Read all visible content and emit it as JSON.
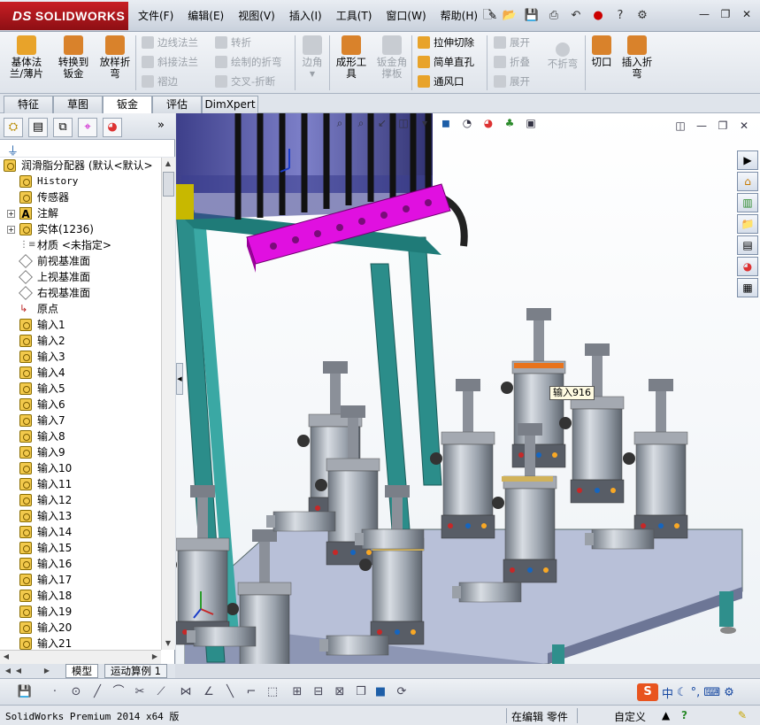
{
  "app": {
    "brand": "SOLIDWORKS",
    "brand_mark": "DS"
  },
  "menu": [
    "文件(F)",
    "编辑(E)",
    "视图(V)",
    "插入(I)",
    "工具(T)",
    "窗口(W)",
    "帮助(H)"
  ],
  "quick_icons": [
    "new-icon",
    "open-icon",
    "save-icon",
    "print-icon",
    "undo-icon",
    "traffic-light-icon",
    "help-icon",
    "options-icon"
  ],
  "window_controls": [
    "minimize-icon",
    "restore-icon",
    "close-icon"
  ],
  "command_manager": {
    "big": [
      {
        "label": "基体法\n兰/薄片",
        "color": "#e8a32a"
      },
      {
        "label": "转换到\n钣金",
        "color": "#d9822b"
      },
      {
        "label": "放样折\n弯",
        "color": "#d9822b"
      }
    ],
    "col1": [
      {
        "label": "边线法兰",
        "disabled": true
      },
      {
        "label": "斜接法兰",
        "disabled": true
      },
      {
        "label": "褶边",
        "disabled": true
      }
    ],
    "col2": [
      {
        "label": "转折",
        "disabled": true
      },
      {
        "label": "绘制的折弯",
        "disabled": true
      },
      {
        "label": "交叉-折断",
        "disabled": true
      }
    ],
    "corner": {
      "label": "边角",
      "disabled": true
    },
    "forming": {
      "label": "成形工\n具"
    },
    "gusset": {
      "label": "钣金角\n撑板",
      "disabled": true
    },
    "col3": [
      {
        "label": "拉伸切除",
        "disabled": false
      },
      {
        "label": "简单直孔",
        "disabled": false
      },
      {
        "label": "通风口",
        "disabled": false
      }
    ],
    "col4": [
      {
        "label": "展开",
        "disabled": true
      },
      {
        "label": "折叠",
        "disabled": true
      },
      {
        "label": "展开",
        "disabled": true
      }
    ],
    "nobend": {
      "label": "不折弯",
      "disabled": true
    },
    "rip": {
      "label": "切口"
    },
    "insert_bends": {
      "label": "插入折\n弯"
    }
  },
  "tabs": [
    "特征",
    "草图",
    "钣金",
    "评估",
    "DimXpert"
  ],
  "active_tab": "钣金",
  "feature_tree": {
    "root": "润滑脂分配器  (默认<默认>",
    "items": [
      {
        "label": "History",
        "icon": "history-icon",
        "expand": false
      },
      {
        "label": "传感器",
        "icon": "sensor-icon",
        "expand": false
      },
      {
        "label": "注解",
        "icon": "annotation-icon",
        "expand": true
      },
      {
        "label": "实体(1236)",
        "icon": "solid-bodies-icon",
        "expand": true
      },
      {
        "label": "材质 <未指定>",
        "icon": "material-icon",
        "expand": false
      },
      {
        "label": "前视基准面",
        "icon": "plane-icon",
        "expand": false
      },
      {
        "label": "上视基准面",
        "icon": "plane-icon",
        "expand": false
      },
      {
        "label": "右视基准面",
        "icon": "plane-icon",
        "expand": false
      },
      {
        "label": "原点",
        "icon": "origin-icon",
        "expand": false
      }
    ],
    "inputs": [
      "输入1",
      "输入2",
      "输入3",
      "输入4",
      "输入5",
      "输入6",
      "输入7",
      "输入8",
      "输入9",
      "输入10",
      "输入11",
      "输入12",
      "输入13",
      "输入14",
      "输入15",
      "输入16",
      "输入17",
      "输入18",
      "输入19",
      "输入20",
      "输入21"
    ]
  },
  "model_tabs": [
    "模型",
    "运动算例 1"
  ],
  "viewport": {
    "tooltip": "输入916"
  },
  "ime": {
    "logo": "S",
    "mode": "中"
  },
  "status": {
    "left": "SolidWorks Premium 2014 x64 版",
    "mode": "在编辑 零件",
    "units": "自定义"
  }
}
